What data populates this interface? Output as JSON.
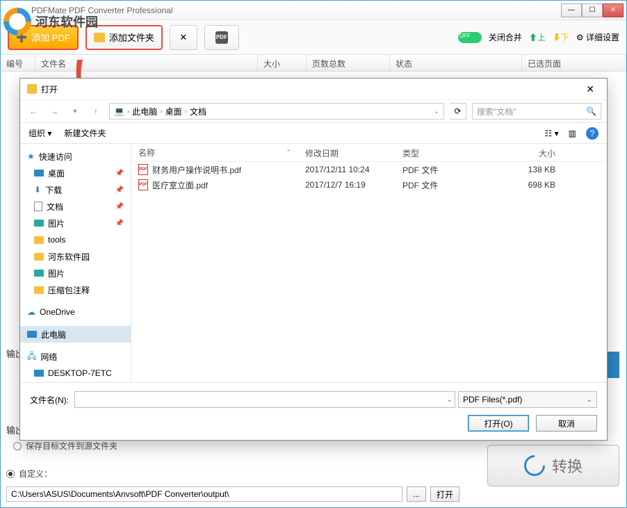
{
  "watermark": "河东软件园",
  "titlebar": {
    "title": "PDFMate PDF Converter Professional"
  },
  "toolbar": {
    "add_pdf": "添加 PDF",
    "add_folder": "添加文件夹",
    "right": {
      "close_merge": "关闭合并",
      "up": "上",
      "down": "下",
      "settings": "详细设置"
    }
  },
  "columns": {
    "num": "编号",
    "name": "文件名",
    "size": "大小",
    "pages": "页数总数",
    "status": "状态",
    "selected": "已选页面"
  },
  "dialog": {
    "title": "打开",
    "breadcrumb": [
      "此电脑",
      "桌面",
      "文档"
    ],
    "search_placeholder": "搜索\"文档\"",
    "organize": "组织",
    "new_folder": "新建文件夹",
    "headers": {
      "name": "名称",
      "date": "修改日期",
      "type": "类型",
      "size": "大小"
    },
    "files": [
      {
        "name": "财务用户操作说明书.pdf",
        "date": "2017/12/11 10:24",
        "type": "PDF 文件",
        "size": "138 KB"
      },
      {
        "name": "医疗室立面.pdf",
        "date": "2017/12/7 16:19",
        "type": "PDF 文件",
        "size": "698 KB"
      }
    ],
    "sidebar": {
      "quick": "快速访问",
      "desktop": "桌面",
      "downloads": "下载",
      "documents": "文档",
      "pictures": "图片",
      "tools": "tools",
      "hedong": "河东软件园",
      "pictures2": "图片",
      "zip": "压缩包注释",
      "onedrive": "OneDrive",
      "thispc": "此电脑",
      "network": "网络",
      "dev": "DESKTOP-7ETC"
    },
    "filename_label": "文件名(N):",
    "filetype": "PDF Files(*.pdf)",
    "open_btn": "打开(O)",
    "cancel_btn": "取消"
  },
  "output": {
    "label_top": "输出",
    "label_bottom": "输出",
    "faded_option": "保存目标文件到源文件夹",
    "custom": "自定义：",
    "path": "C:\\Users\\ASUS\\Documents\\Anvsoft\\PDF Converter\\output\\",
    "browse": "...",
    "open": "打开",
    "convert": "转换"
  }
}
